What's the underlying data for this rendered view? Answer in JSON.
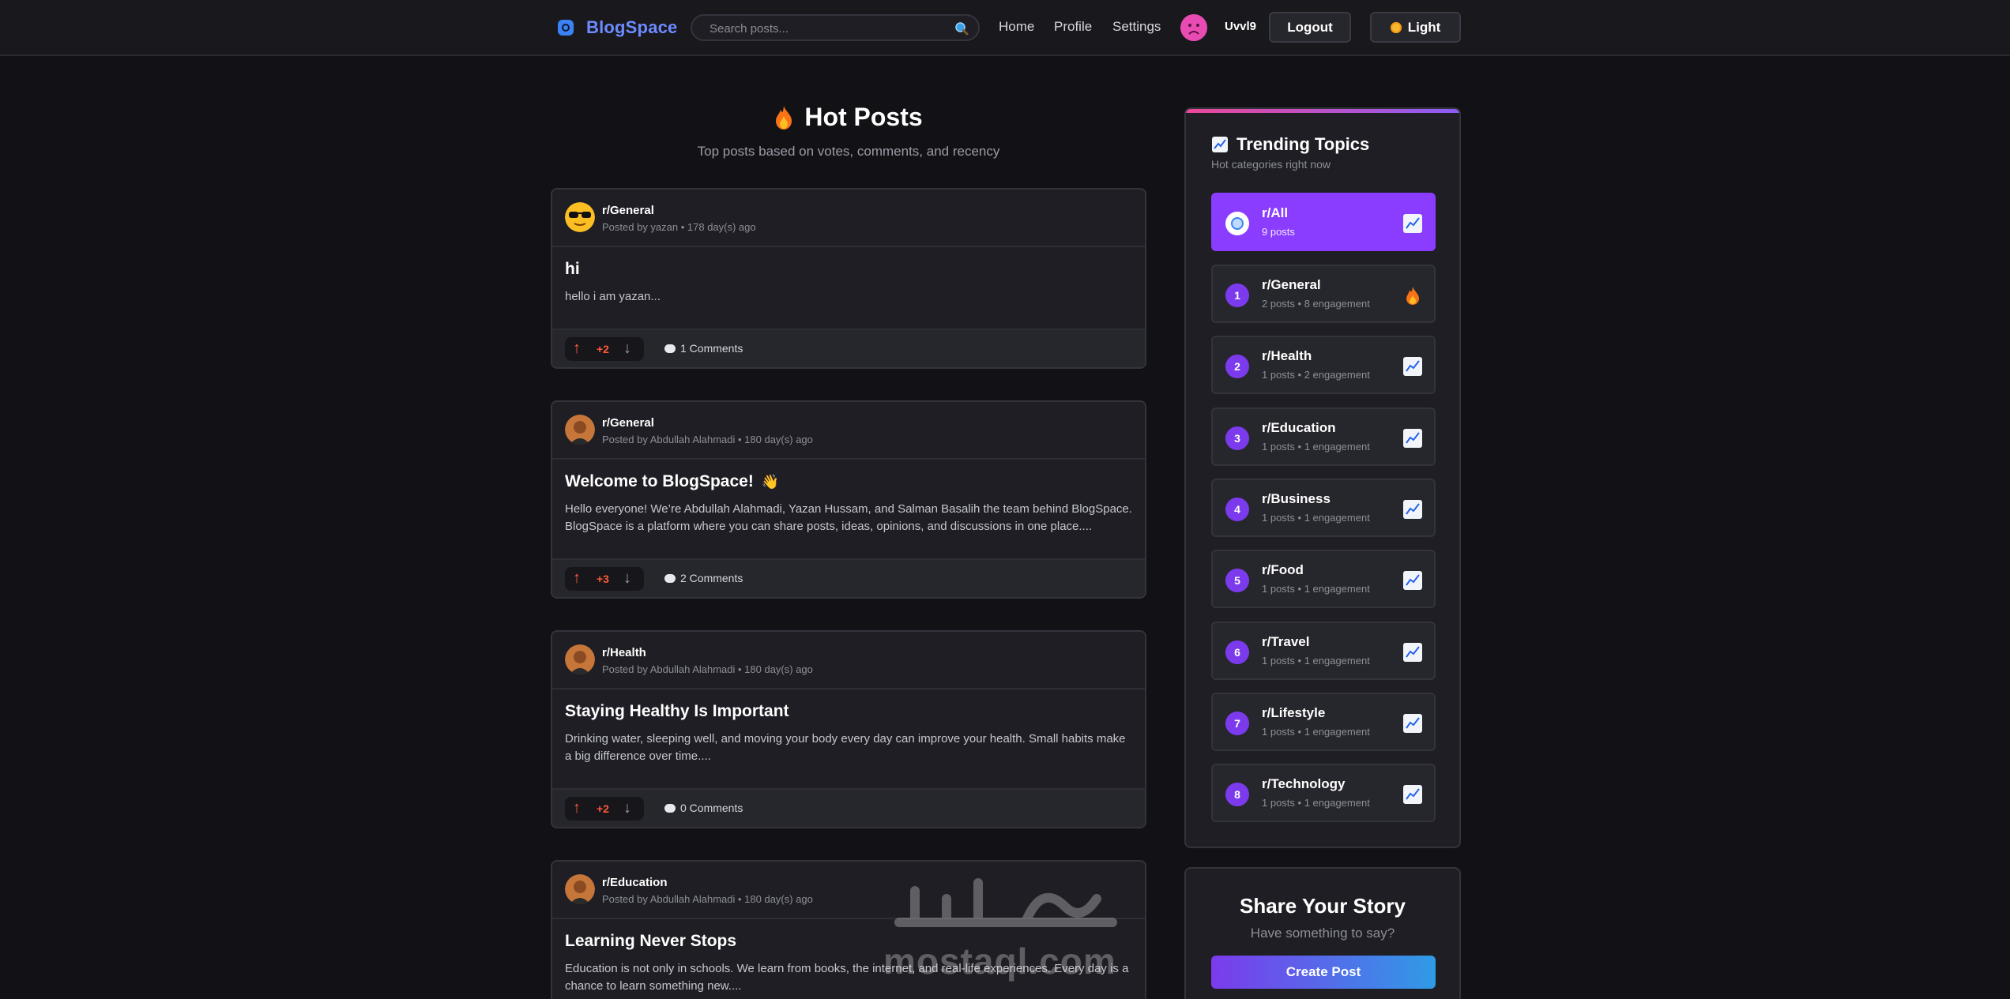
{
  "header": {
    "logo_text": "BlogSpace",
    "search_placeholder": "Search posts...",
    "nav": {
      "home": "Home",
      "profile": "Profile",
      "settings": "Settings"
    },
    "username": "Uvvl9",
    "logout_label": "Logout",
    "theme_label": "Light"
  },
  "main": {
    "title": "Hot Posts",
    "subtitle": "Top posts based on votes, comments, and recency",
    "posts": [
      {
        "subreddit": "r/General",
        "meta": "Posted by yazan • 178 day(s) ago",
        "title": "hi",
        "body": "hello i am yazan...",
        "votes": "+2",
        "comments": "1 Comments"
      },
      {
        "subreddit": "r/General",
        "meta": "Posted by Abdullah Alahmadi • 180 day(s) ago",
        "title": "Welcome to BlogSpace!",
        "title_emoji": "👋",
        "body": "Hello everyone! We’re Abdullah Alahmadi, Yazan Hussam, and Salman Basalih the team behind BlogSpace. BlogSpace is a platform where you can share posts, ideas, opinions, and discussions in one place....",
        "votes": "+3",
        "comments": "2 Comments"
      },
      {
        "subreddit": "r/Health",
        "meta": "Posted by Abdullah Alahmadi • 180 day(s) ago",
        "title": "Staying Healthy Is Important",
        "body": "Drinking water, sleeping well, and moving your body every day can improve your health. Small habits make a big difference over time....",
        "votes": "+2",
        "comments": "0 Comments"
      },
      {
        "subreddit": "r/Education",
        "meta": "Posted by Abdullah Alahmadi • 180 day(s) ago",
        "title": "Learning Never Stops",
        "body": "Education is not only in schools. We learn from books, the internet, and real-life experiences. Every day is a chance to learn something new...."
      }
    ]
  },
  "sidebar": {
    "trending_title": "Trending Topics",
    "trending_subtitle": "Hot categories right now",
    "topics": [
      {
        "rank": "",
        "name": "r/All",
        "stats": "9 posts",
        "icon": "chart-up-icon",
        "active": true
      },
      {
        "rank": "1",
        "name": "r/General",
        "stats": "2 posts • 8 engagement",
        "icon": "flame-icon"
      },
      {
        "rank": "2",
        "name": "r/Health",
        "stats": "1 posts • 2 engagement",
        "icon": "chart-up-icon"
      },
      {
        "rank": "3",
        "name": "r/Education",
        "stats": "1 posts • 1 engagement",
        "icon": "chart-up-icon"
      },
      {
        "rank": "4",
        "name": "r/Business",
        "stats": "1 posts • 1 engagement",
        "icon": "chart-up-icon"
      },
      {
        "rank": "5",
        "name": "r/Food",
        "stats": "1 posts • 1 engagement",
        "icon": "chart-up-icon"
      },
      {
        "rank": "6",
        "name": "r/Travel",
        "stats": "1 posts • 1 engagement",
        "icon": "chart-up-icon"
      },
      {
        "rank": "7",
        "name": "r/Lifestyle",
        "stats": "1 posts • 1 engagement",
        "icon": "chart-up-icon"
      },
      {
        "rank": "8",
        "name": "r/Technology",
        "stats": "1 posts • 1 engagement",
        "icon": "chart-up-icon"
      }
    ],
    "share_title": "Share Your Story",
    "share_subtitle": "Have something to say?",
    "create_label": "Create Post"
  },
  "watermark": {
    "arabic": "مستقل",
    "latin": "mostaql.com"
  },
  "colors": {
    "accent": "#8b3dff",
    "brand": "#6d8bff",
    "vote": "#ff5a36",
    "background": "#121216"
  }
}
